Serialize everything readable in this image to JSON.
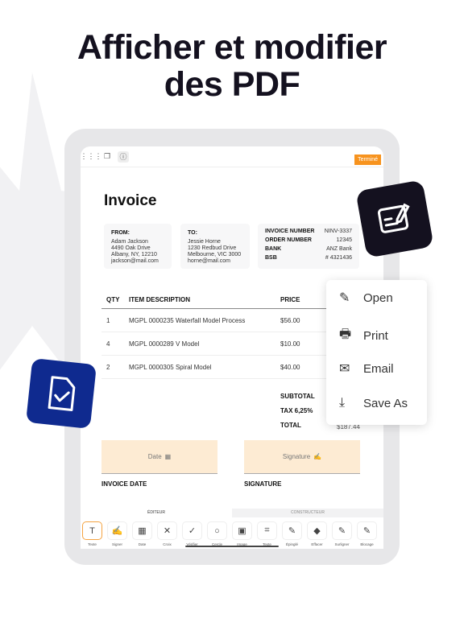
{
  "headline": {
    "line1": "Afficher et modifier",
    "line2": "des PDF"
  },
  "toolbar": {
    "done_label": "Terminé",
    "icons": [
      "grid-icon",
      "copy-icon",
      "info-icon"
    ]
  },
  "invoice": {
    "title": "Invoice",
    "from": {
      "label": "FROM:",
      "lines": [
        "Adam Jackson",
        "4490 Oak Drive",
        "Albany, NY, 12210",
        "jackson@mail.com"
      ]
    },
    "to": {
      "label": "TO:",
      "lines": [
        "Jessie Horne",
        "1230 Redbud Drive",
        "Melbourne, VIC 3000",
        "horne@mail.com"
      ]
    },
    "meta": [
      {
        "k": "INVOICE NUMBER",
        "v": "NINV-3337"
      },
      {
        "k": "ORDER NUMBER",
        "v": "12345"
      },
      {
        "k": "BANK",
        "v": "ANZ Bank"
      },
      {
        "k": "BSB",
        "v": "# 4321436"
      }
    ],
    "columns": {
      "qty": "QTY",
      "desc": "ITEM DESCRIPTION",
      "price": "PRICE"
    },
    "rows": [
      {
        "qty": "1",
        "desc": "MGPL 0000235 Waterfall Model Process",
        "price": "$56.00"
      },
      {
        "qty": "4",
        "desc": "MGPL 0000289 V Model",
        "price": "$10.00"
      },
      {
        "qty": "2",
        "desc": "MGPL 0000305 Spiral Model",
        "price": "$40.00"
      }
    ],
    "subtotal_label": "SUBTOTAL",
    "tax_label": "TAX 6,25%",
    "total_label": "TOTAL",
    "total_value": "$187.44",
    "date_field": "Date",
    "signature_field": "Signature",
    "invoice_date_label": "INVOICE DATE",
    "signature_label": "SIGNATURE"
  },
  "tabs": {
    "editor": "ÉDITEUR",
    "builder": "CONSTRUCTEUR"
  },
  "tools": [
    {
      "label": "Texte",
      "glyph": "T"
    },
    {
      "label": "Signer",
      "glyph": "✍"
    },
    {
      "label": "Date",
      "glyph": "▦"
    },
    {
      "label": "Croix",
      "glyph": "✕"
    },
    {
      "label": "Vérifier",
      "glyph": "✓"
    },
    {
      "label": "Cercle",
      "glyph": "○"
    },
    {
      "label": "Image",
      "glyph": "▣"
    },
    {
      "label": "Texte",
      "glyph": "⌗"
    },
    {
      "label": "Épinglé",
      "glyph": "✎"
    },
    {
      "label": "Effacer",
      "glyph": "◆"
    },
    {
      "label": "Surligner",
      "glyph": "✎"
    },
    {
      "label": "Blocage",
      "glyph": "✎"
    }
  ],
  "menu": [
    {
      "label": "Open",
      "icon": "edit-icon",
      "glyph": "✎"
    },
    {
      "label": "Print",
      "icon": "printer-icon",
      "glyph": "🖶"
    },
    {
      "label": "Email",
      "icon": "mail-icon",
      "glyph": "✉"
    },
    {
      "label": "Save As",
      "icon": "download-icon",
      "glyph": "⤓"
    }
  ],
  "colors": {
    "accent": "#f7931e",
    "dark": "#14111f",
    "blue": "#0f2a8f",
    "field": "#fdebd3"
  }
}
